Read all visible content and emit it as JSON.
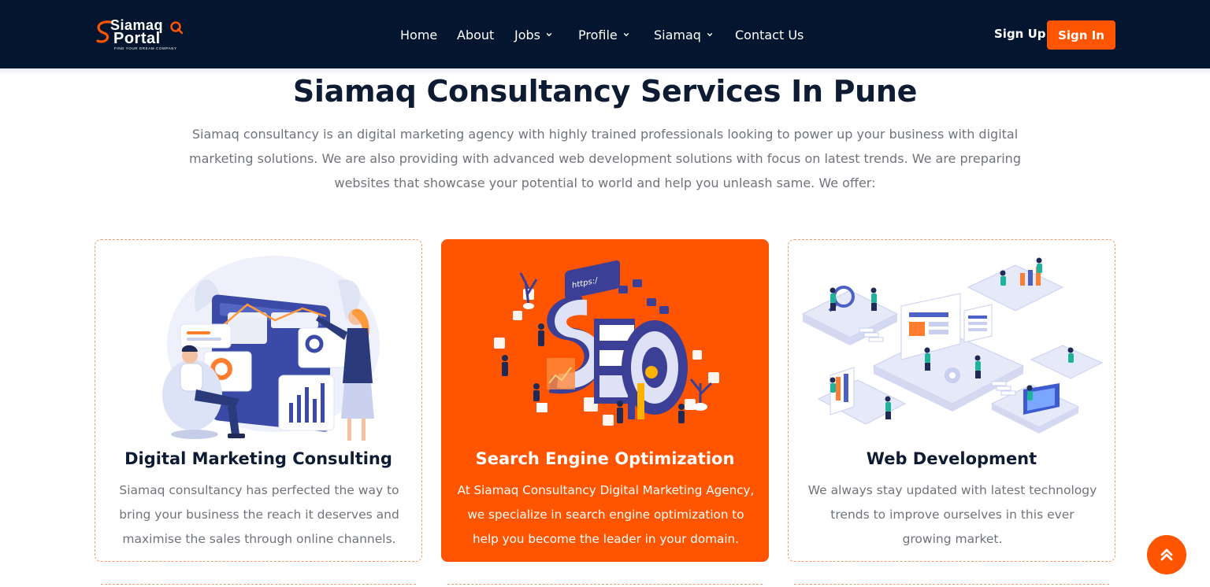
{
  "logo": {
    "line1": "Siamaq",
    "line2": "Portal",
    "tagline": "FIND YOUR DREAM COMPANY"
  },
  "nav": {
    "items": [
      {
        "label": "Home",
        "dropdown": false
      },
      {
        "label": "About",
        "dropdown": false
      },
      {
        "label": "Jobs",
        "dropdown": true
      },
      {
        "label": "Profile",
        "dropdown": true
      },
      {
        "label": "Siamaq",
        "dropdown": true
      },
      {
        "label": "Contact Us",
        "dropdown": false
      }
    ],
    "signup_label": "Sign Up",
    "signin_label": "Sign In"
  },
  "main": {
    "heading": "Siamaq Consultancy Services In Pune",
    "intro": "Siamaq consultancy is an digital marketing agency with highly trained professionals looking to power up your business with digital marketing solutions. We are also providing with advanced web development solutions with focus on latest trends. We are preparing websites that showcase your potential to world and help you unleash same. We offer:"
  },
  "services": [
    {
      "title": "Digital Marketing Consulting",
      "description": "Siamaq consultancy has perfected the way to bring your business the reach it deserves and maximise the sales through online channels.",
      "illustration": "digital-marketing-illustration"
    },
    {
      "title": "Search Engine Optimization",
      "description": "At Siamaq Consultancy Digital Marketing Agency, we specialize in search engine optimization to help you become the leader in your domain.",
      "illustration": "seo-illustration"
    },
    {
      "title": "Web Development",
      "description": "We always stay updated with latest technology trends to improve ourselves in this ever growing market.",
      "illustration": "web-development-illustration"
    }
  ],
  "seo_illustration_text": "https:/",
  "colors": {
    "nav_bg": "#041530",
    "accent": "#ff5400",
    "heading": "#0d1b33",
    "body_text": "#6f737a"
  },
  "scroll_top_icon": "double-chevron-up-icon"
}
